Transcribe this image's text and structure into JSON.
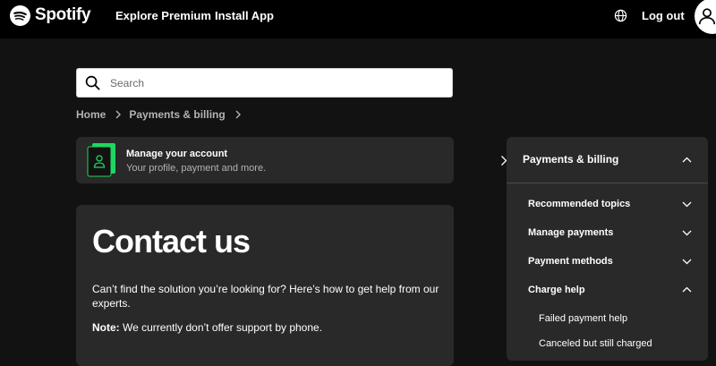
{
  "header": {
    "brand": "Spotify",
    "nav": [
      "Explore Premium",
      "Install App"
    ],
    "logout": "Log out"
  },
  "search": {
    "placeholder": "Search",
    "value": ""
  },
  "breadcrumb": [
    "Home",
    "Payments & billing"
  ],
  "account_card": {
    "title": "Manage your account",
    "subtitle": "Your profile, payment and more."
  },
  "contact": {
    "title": "Contact us",
    "text": "Can’t find the solution you’re looking for? Here’s how to get help from our experts.",
    "note_label": "Note:",
    "note_text": " We currently don’t offer support by phone."
  },
  "sidebar": {
    "header": "Payments & billing",
    "items": [
      "Recommended topics",
      "Manage payments",
      "Payment methods",
      "Charge help"
    ],
    "sub_items": [
      "Failed payment help",
      "Canceled but still charged"
    ]
  },
  "colors": {
    "brand_green": "#1ed760",
    "bg": "#121212",
    "card": "#292929"
  }
}
